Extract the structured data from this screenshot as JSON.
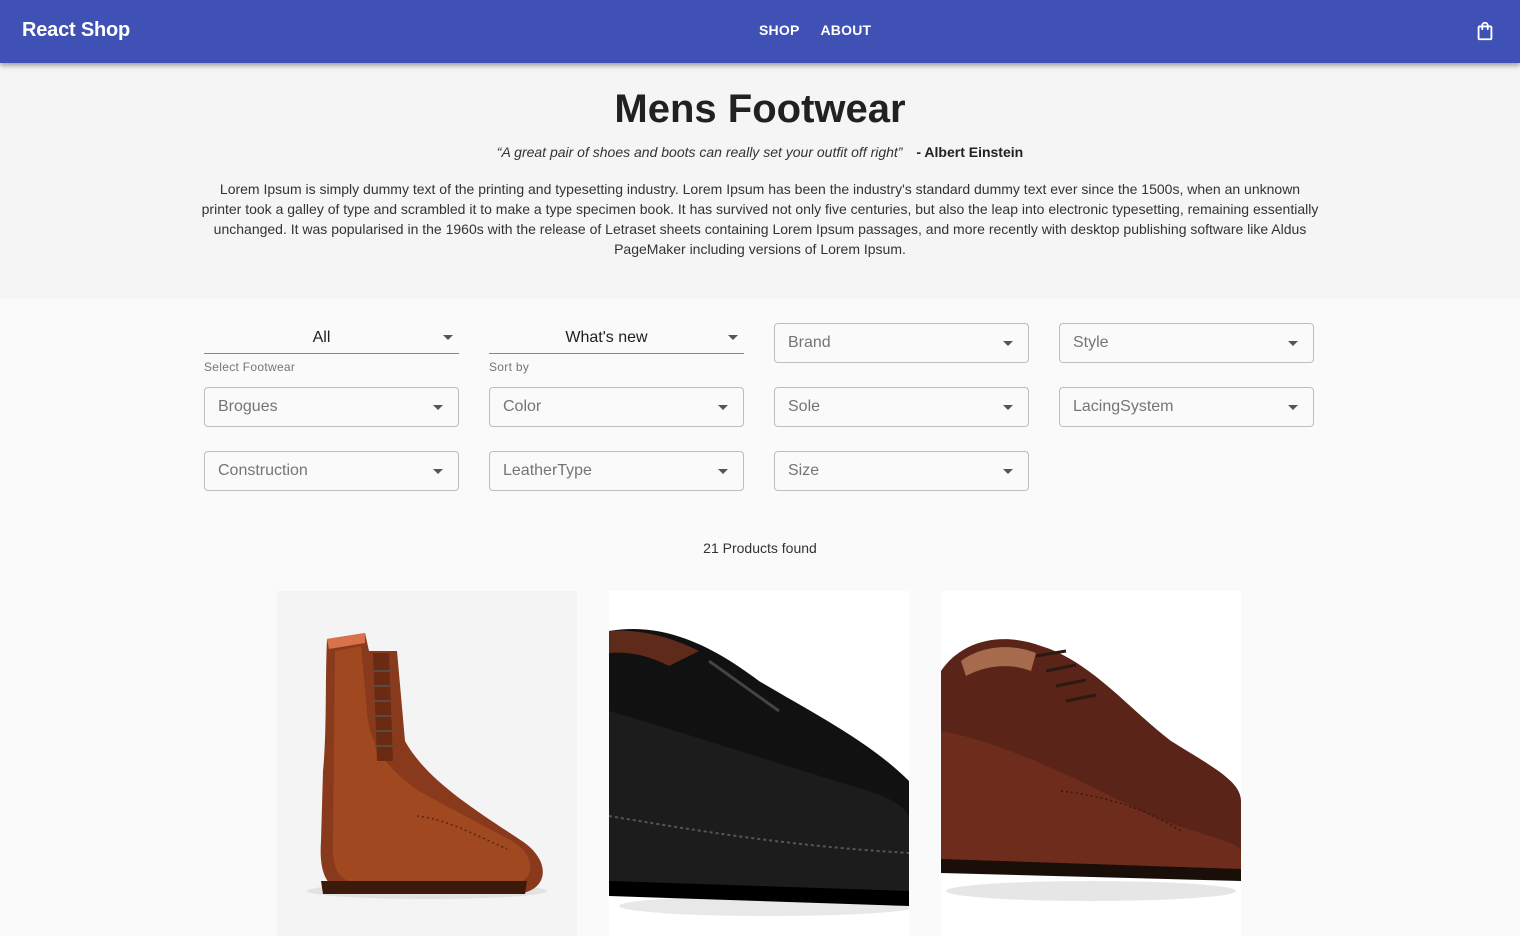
{
  "app": {
    "brand": "React Shop",
    "nav": [
      "SHOP",
      "ABOUT"
    ],
    "cart_icon": "shopping-bag-icon"
  },
  "hero": {
    "title": "Mens Footwear",
    "quote": "“A great pair of shoes and boots can really set your outfit off right”",
    "author": "- Albert Einstein",
    "description": "Lorem Ipsum is simply dummy text of the printing and typesetting industry. Lorem Ipsum has been the industry's standard dummy text ever since the 1500s, when an unknown printer took a galley of type and scrambled it to make a type specimen book. It has survived not only five centuries, but also the leap into electronic typesetting, remaining essentially unchanged. It was popularised in the 1960s with the release of Letraset sheets containing Lorem Ipsum passages, and more recently with desktop publishing software like Aldus PageMaker including versions of Lorem Ipsum."
  },
  "filters": {
    "footwear": {
      "value": "All",
      "helper": "Select Footwear"
    },
    "sort": {
      "value": "What's new",
      "helper": "Sort by"
    },
    "brand": "Brand",
    "style": "Style",
    "brogues": "Brogues",
    "color": "Color",
    "sole": "Sole",
    "lacing": "LacingSystem",
    "construction": "Construction",
    "leather": "LeatherType",
    "size": "Size"
  },
  "results": {
    "count_text": "21 Products found"
  },
  "colors": {
    "primary": "#3f51b5",
    "background": "#fafafa"
  }
}
